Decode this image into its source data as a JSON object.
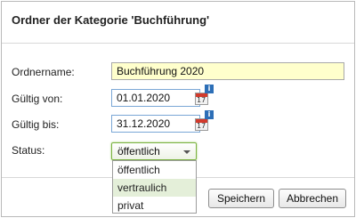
{
  "dialog": {
    "title": "Ordner der Kategorie 'Buchführung'"
  },
  "form": {
    "name_label": "Ordnername:",
    "name_value": "Buchführung 2020",
    "valid_from_label": "Gültig von:",
    "valid_from_value": "01.01.2020",
    "valid_to_label": "Gültig bis:",
    "valid_to_value": "31.12.2020",
    "status_label": "Status:",
    "status_value": "öffentlich",
    "calendar_icon_text": "17",
    "info_icon_text": "i"
  },
  "status_options": [
    "öffentlich",
    "vertraulich",
    "privat"
  ],
  "buttons": {
    "save": "Speichern",
    "cancel": "Abbrechen"
  },
  "colors": {
    "name_field_bg": "#ffffcc",
    "select_border": "#7cb342",
    "option_hover": "#e4efd9",
    "info_badge": "#2d6fb7",
    "calendar_header": "#d23a2c"
  },
  "icons": [
    "calendar-icon",
    "info-icon",
    "chevron-down-icon"
  ]
}
